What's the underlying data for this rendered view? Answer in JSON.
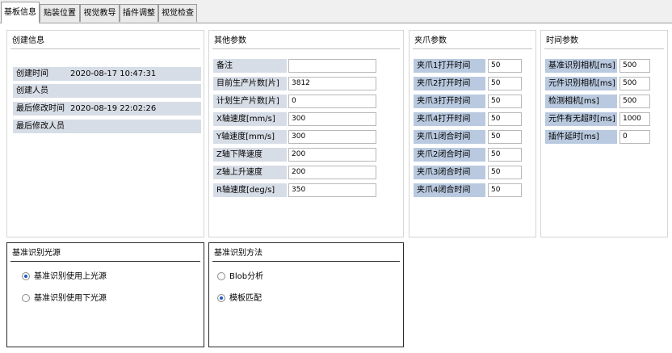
{
  "tabs": [
    "基板信息",
    "贴装位置",
    "视觉教导",
    "插件调整",
    "视觉检查"
  ],
  "create_info": {
    "title": "创建信息",
    "rows": [
      {
        "label": "创建时间",
        "value": "2020-08-17 10:47:31"
      },
      {
        "label": "创建人员",
        "value": ""
      },
      {
        "label": "最后修改时间",
        "value": "2020-08-19 22:02:26"
      },
      {
        "label": "最后修改人员",
        "value": ""
      }
    ]
  },
  "other_params": {
    "title": "其他参数",
    "rows": [
      {
        "label": "备注",
        "value": ""
      },
      {
        "label": "目前生产片数[片]",
        "value": "3812"
      },
      {
        "label": "计划生产片数[片]",
        "value": "0"
      },
      {
        "label": "X轴速度[mm/s]",
        "value": "300"
      },
      {
        "label": "Y轴速度[mm/s]",
        "value": "300"
      },
      {
        "label": "Z轴下降速度",
        "value": "200"
      },
      {
        "label": "Z轴上升速度",
        "value": "200"
      },
      {
        "label": "R轴速度[deg/s]",
        "value": "350"
      }
    ]
  },
  "gripper_params": {
    "title": "夹爪参数",
    "rows": [
      {
        "label": "夹爪1打开时间",
        "value": "50"
      },
      {
        "label": "夹爪2打开时间",
        "value": "50"
      },
      {
        "label": "夹爪3打开时间",
        "value": "50"
      },
      {
        "label": "夹爪4打开时间",
        "value": "50"
      },
      {
        "label": "夹爪1闭合时间",
        "value": "50"
      },
      {
        "label": "夹爪2闭合时间",
        "value": "50"
      },
      {
        "label": "夹爪3闭合时间",
        "value": "50"
      },
      {
        "label": "夹爪4闭合时间",
        "value": "50"
      }
    ]
  },
  "time_params": {
    "title": "时间参数",
    "rows": [
      {
        "label": "基准识别相机[ms]",
        "value": "500"
      },
      {
        "label": "元件识别相机[ms]",
        "value": "500"
      },
      {
        "label": "检测相机[ms]",
        "value": "500"
      },
      {
        "label": "元件有无超时[ms]",
        "value": "1000"
      },
      {
        "label": "插件延时[ms]",
        "value": "0"
      }
    ]
  },
  "light_source": {
    "title": "基准识别光源",
    "options": [
      {
        "label": "基准识别使用上光源",
        "selected": true
      },
      {
        "label": "基准识别使用下光源",
        "selected": false
      }
    ]
  },
  "method": {
    "title": "基准识别方法",
    "options": [
      {
        "label": "Blob分析",
        "selected": false
      },
      {
        "label": "模板匹配",
        "selected": true
      }
    ]
  }
}
